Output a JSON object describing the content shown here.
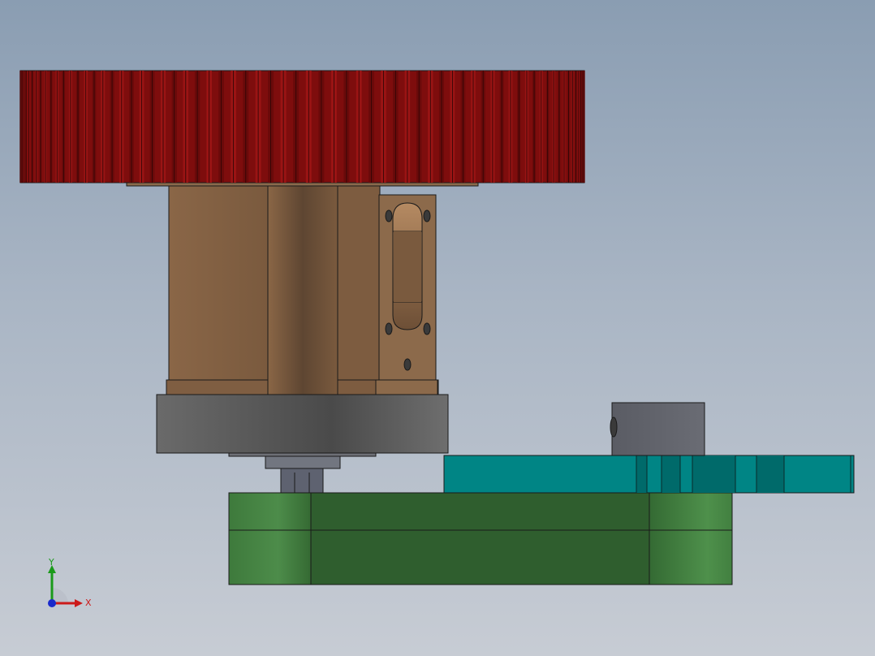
{
  "viewport": {
    "background_top": "#8a9db2",
    "background_bottom": "#c7ccd4"
  },
  "model": {
    "parts": [
      {
        "name": "spur-gear",
        "color": "#8b0f0f"
      },
      {
        "name": "motor-housing",
        "color": "#8e6a4a"
      },
      {
        "name": "mounting-bracket",
        "color": "#8e6a4a"
      },
      {
        "name": "motor-flange",
        "color": "#5c5c5c"
      },
      {
        "name": "shaft-coupling",
        "color": "#6a6f78"
      },
      {
        "name": "gear-rack",
        "color": "#008a8a"
      },
      {
        "name": "rack-clamp",
        "color": "#5c5e66"
      },
      {
        "name": "base-block",
        "color": "#356b34"
      }
    ]
  },
  "triad": {
    "x_label": "X",
    "y_label": "Y",
    "x_color": "#cc1a1a",
    "y_color": "#1a9a1a",
    "z_color": "#1a2acc"
  }
}
